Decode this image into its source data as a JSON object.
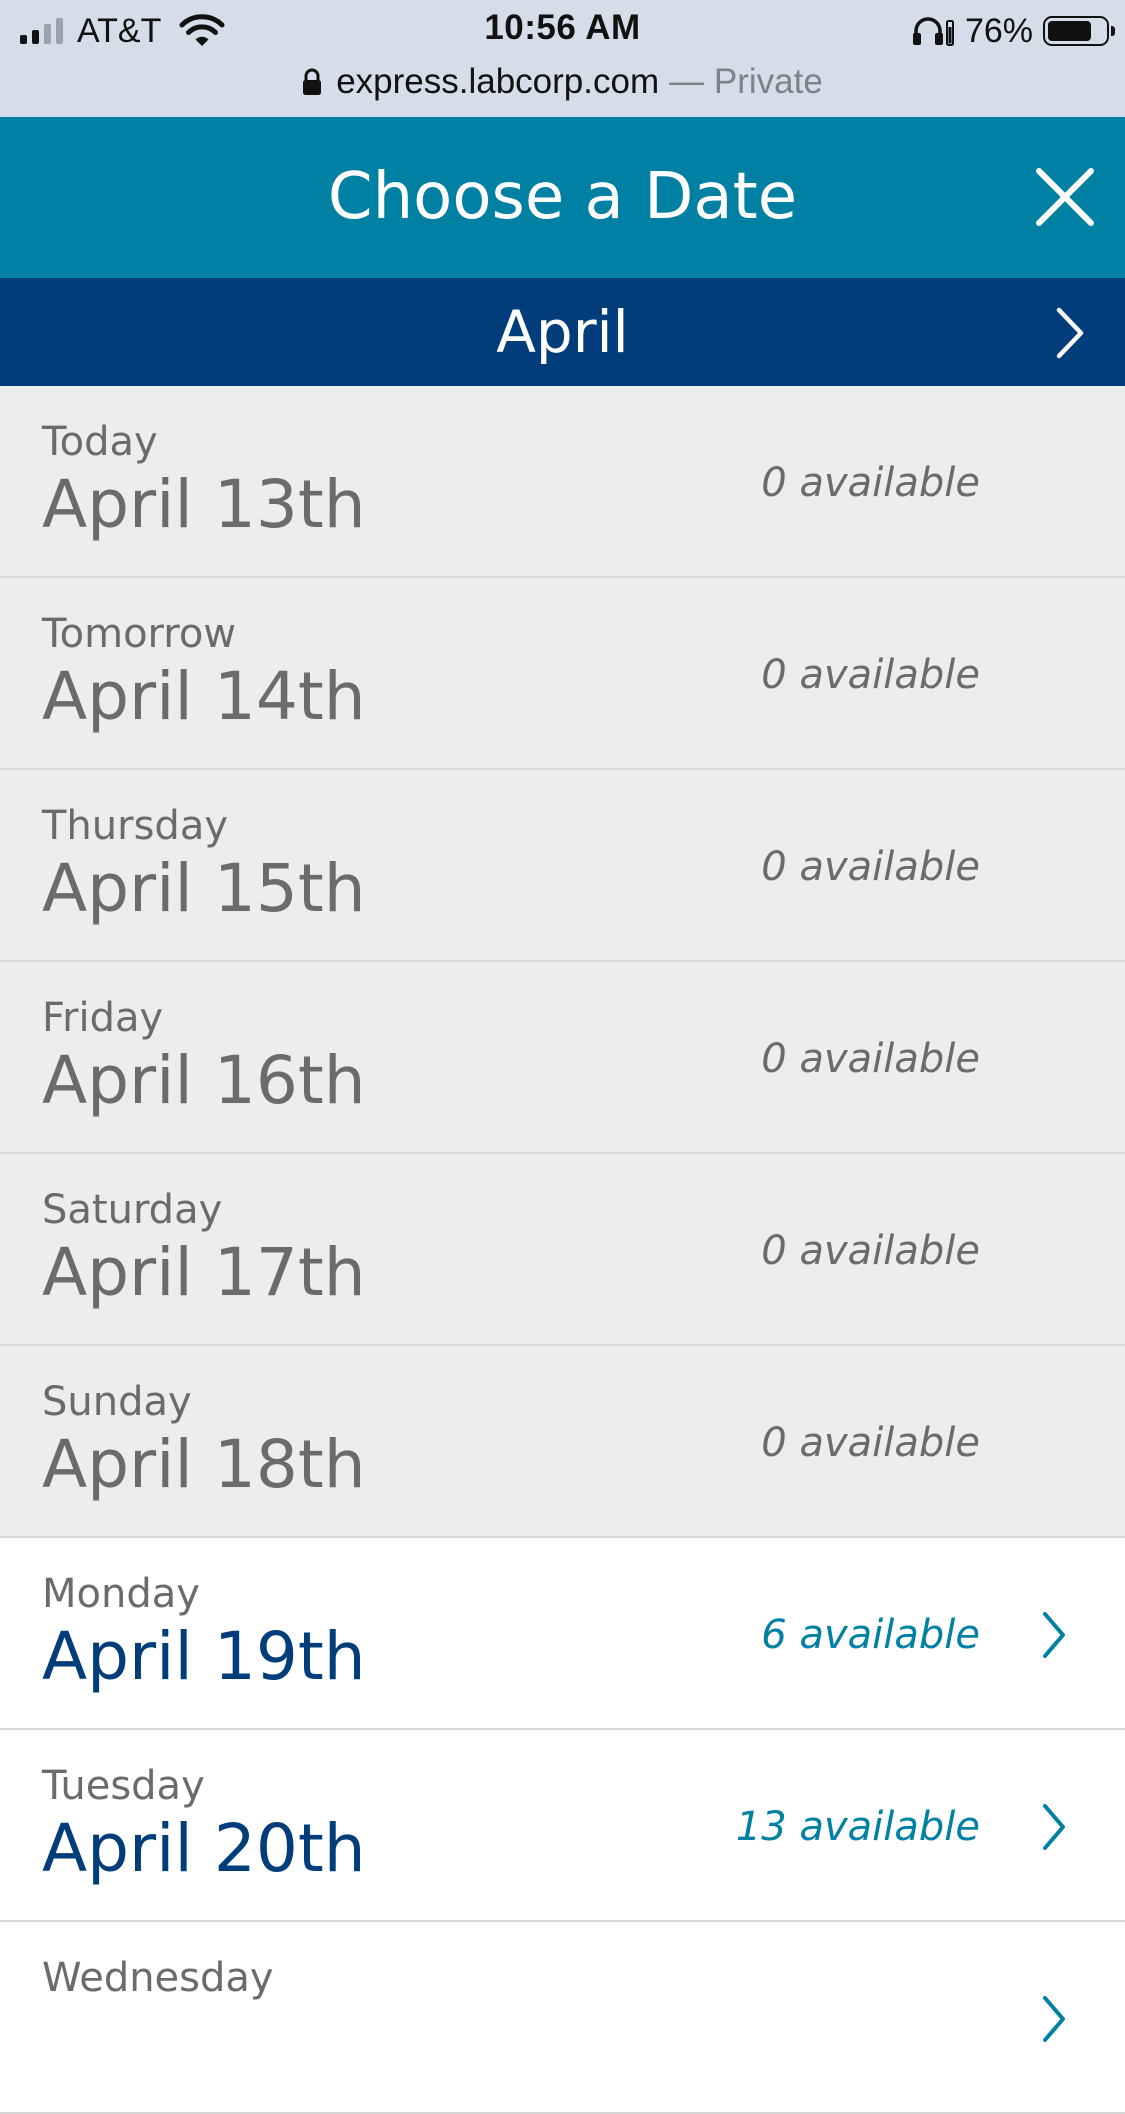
{
  "status_bar": {
    "carrier": "AT&T",
    "time": "10:56 AM",
    "battery": "76%",
    "battery_level": 0.76,
    "url_domain": "express.labcorp.com",
    "url_private": "— Private"
  },
  "header": {
    "title": "Choose a Date",
    "close_icon": "close-icon"
  },
  "month_bar": {
    "month": "April",
    "next_icon": "chevron-right-icon"
  },
  "colors": {
    "header_bg": "#0080a3",
    "month_bg": "#003d7a",
    "available_text": "#0080a3",
    "available_date": "#003d7a",
    "unavailable_bg": "#ededed",
    "unavailable_text": "#6b6b6b"
  },
  "dates": [
    {
      "day": "Today",
      "date": "April 13th",
      "availability": "0 available",
      "count": 0
    },
    {
      "day": "Tomorrow",
      "date": "April 14th",
      "availability": "0 available",
      "count": 0
    },
    {
      "day": "Thursday",
      "date": "April 15th",
      "availability": "0 available",
      "count": 0
    },
    {
      "day": "Friday",
      "date": "April 16th",
      "availability": "0 available",
      "count": 0
    },
    {
      "day": "Saturday",
      "date": "April 17th",
      "availability": "0 available",
      "count": 0
    },
    {
      "day": "Sunday",
      "date": "April 18th",
      "availability": "0 available",
      "count": 0
    },
    {
      "day": "Monday",
      "date": "April 19th",
      "availability": "6 available",
      "count": 6
    },
    {
      "day": "Tuesday",
      "date": "April 20th",
      "availability": "13 available",
      "count": 13
    },
    {
      "day": "Wednesday",
      "date": "",
      "availability": "",
      "count": null
    }
  ]
}
